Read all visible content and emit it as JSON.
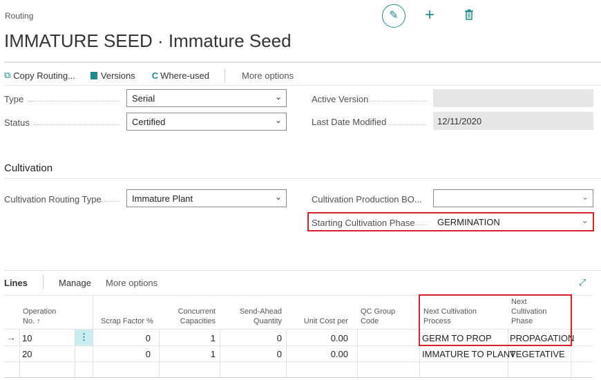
{
  "header": {
    "breadcrumb": "Routing",
    "title": "IMMATURE SEED · Immature Seed",
    "icons": [
      "edit-icon",
      "add-icon",
      "delete-icon"
    ]
  },
  "actions": {
    "copy_routing": "Copy Routing...",
    "versions": "Versions",
    "where_used": "Where-used",
    "more_options": "More options"
  },
  "general": {
    "type": {
      "label": "Type",
      "value": "Serial"
    },
    "status": {
      "label": "Status",
      "value": "Certified"
    },
    "active_version": {
      "label": "Active Version",
      "value": ""
    },
    "last_date_modified": {
      "label": "Last Date Modified",
      "value": "12/11/2020"
    }
  },
  "cultivation": {
    "title": "Cultivation",
    "routing_type": {
      "label": "Cultivation Routing Type",
      "value": "Immature Plant"
    },
    "production_bom": {
      "label": "Cultivation Production BO...",
      "value": ""
    },
    "starting_phase": {
      "label": "Starting Cultivation Phase",
      "value": "GERMINATION"
    }
  },
  "lines": {
    "title": "Lines",
    "manage": "Manage",
    "more_options": "More options",
    "columns": {
      "op1": "Operation",
      "op2": "No. ↑",
      "scrap": "Scrap Factor %",
      "conc1": "Concurrent",
      "conc2": "Capacities",
      "send1": "Send-Ahead",
      "send2": "Quantity",
      "unit": "Unit Cost per",
      "qc1": "QC Group",
      "qc2": "Code",
      "proc1": "Next Cultivation",
      "proc2": "Process",
      "ph1": "Next",
      "ph2": "Cultivation",
      "ph3": "Phase"
    },
    "rows": [
      {
        "op": "10",
        "scrap": "0",
        "conc": "1",
        "send": "0",
        "unit": "0.00",
        "qc": "",
        "process": "GERM TO PROP",
        "phase": "PROPAGATION"
      },
      {
        "op": "20",
        "scrap": "0",
        "conc": "1",
        "send": "0",
        "unit": "0.00",
        "qc": "",
        "process": "IMMATURE TO PLANT",
        "phase": "VEGETATIVE"
      }
    ]
  },
  "colors": {
    "accent": "#1f8a8a",
    "highlight": "#d6202a"
  }
}
